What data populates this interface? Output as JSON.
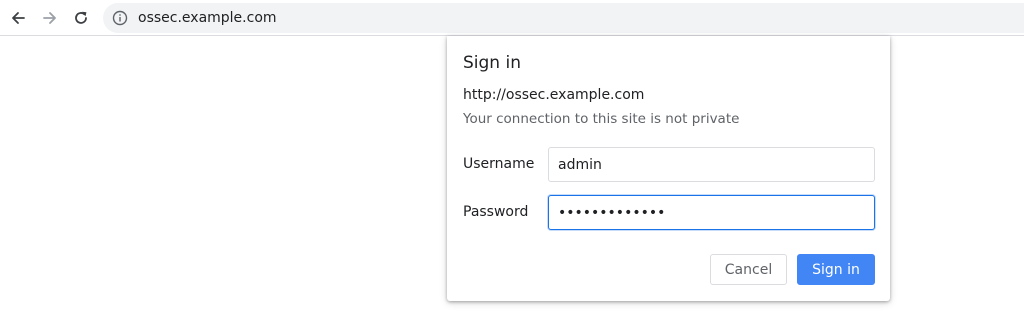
{
  "browser": {
    "url": "ossec.example.com",
    "icons": {
      "back": "arrow-left-icon",
      "forward": "arrow-right-icon",
      "reload": "reload-icon",
      "site_info": "info-icon"
    }
  },
  "dialog": {
    "title": "Sign in",
    "origin": "http://ossec.example.com",
    "warning": "Your connection to this site is not private",
    "username": {
      "label": "Username",
      "value": "admin"
    },
    "password": {
      "label": "Password",
      "value": "•••••••••••••"
    },
    "buttons": {
      "cancel": "Cancel",
      "sign_in": "Sign in"
    }
  },
  "colors": {
    "accent": "#4285f4",
    "focus": "#1a73e8",
    "muted_text": "#5f6368"
  }
}
